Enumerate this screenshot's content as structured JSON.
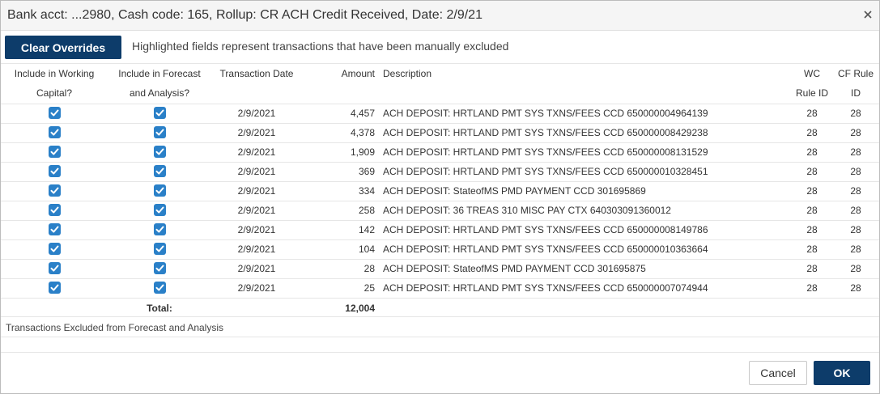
{
  "dialog": {
    "title": "Bank acct: ...2980, Cash code: 165, Rollup: CR ACH Credit Received, Date: 2/9/21",
    "close_icon": "close-icon"
  },
  "toolbar": {
    "clear_label": "Clear Overrides",
    "hint": "Highlighted fields represent transactions that have been manually excluded"
  },
  "columns": {
    "include_wc": [
      "Include in Working",
      "Capital?"
    ],
    "include_fa": [
      "Include in Forecast",
      "and Analysis?"
    ],
    "date": "Transaction Date",
    "amount": "Amount",
    "description": "Description",
    "wc_rule": [
      "WC",
      "Rule ID"
    ],
    "cf_rule": [
      "CF Rule",
      "ID"
    ]
  },
  "colors": {
    "primary": "#0d3c6a",
    "checkbox": "#2a80c8"
  },
  "rows": [
    {
      "include_wc": true,
      "include_fa": true,
      "date": "2/9/2021",
      "amount": "4,457",
      "description": "ACH DEPOSIT: HRTLAND PMT SYS TXNS/FEES CCD 650000004964139",
      "wc_rule": "28",
      "cf_rule": "28"
    },
    {
      "include_wc": true,
      "include_fa": true,
      "date": "2/9/2021",
      "amount": "4,378",
      "description": "ACH DEPOSIT: HRTLAND PMT SYS TXNS/FEES CCD 650000008429238",
      "wc_rule": "28",
      "cf_rule": "28"
    },
    {
      "include_wc": true,
      "include_fa": true,
      "date": "2/9/2021",
      "amount": "1,909",
      "description": "ACH DEPOSIT: HRTLAND PMT SYS TXNS/FEES CCD 650000008131529",
      "wc_rule": "28",
      "cf_rule": "28"
    },
    {
      "include_wc": true,
      "include_fa": true,
      "date": "2/9/2021",
      "amount": "369",
      "description": "ACH DEPOSIT: HRTLAND PMT SYS TXNS/FEES CCD 650000010328451",
      "wc_rule": "28",
      "cf_rule": "28"
    },
    {
      "include_wc": true,
      "include_fa": true,
      "date": "2/9/2021",
      "amount": "334",
      "description": "ACH DEPOSIT: StateofMS PMD PAYMENT CCD 301695869",
      "wc_rule": "28",
      "cf_rule": "28"
    },
    {
      "include_wc": true,
      "include_fa": true,
      "date": "2/9/2021",
      "amount": "258",
      "description": "ACH DEPOSIT: 36 TREAS 310 MISC PAY CTX 640303091360012",
      "wc_rule": "28",
      "cf_rule": "28"
    },
    {
      "include_wc": true,
      "include_fa": true,
      "date": "2/9/2021",
      "amount": "142",
      "description": "ACH DEPOSIT: HRTLAND PMT SYS TXNS/FEES CCD 650000008149786",
      "wc_rule": "28",
      "cf_rule": "28"
    },
    {
      "include_wc": true,
      "include_fa": true,
      "date": "2/9/2021",
      "amount": "104",
      "description": "ACH DEPOSIT: HRTLAND PMT SYS TXNS/FEES CCD 650000010363664",
      "wc_rule": "28",
      "cf_rule": "28"
    },
    {
      "include_wc": true,
      "include_fa": true,
      "date": "2/9/2021",
      "amount": "28",
      "description": "ACH DEPOSIT: StateofMS PMD PAYMENT CCD 301695875",
      "wc_rule": "28",
      "cf_rule": "28"
    },
    {
      "include_wc": true,
      "include_fa": true,
      "date": "2/9/2021",
      "amount": "25",
      "description": "ACH DEPOSIT: HRTLAND PMT SYS TXNS/FEES CCD 650000007074944",
      "wc_rule": "28",
      "cf_rule": "28"
    }
  ],
  "total": {
    "label": "Total:",
    "amount": "12,004"
  },
  "excluded_section": {
    "label": "Transactions Excluded from Forecast and Analysis"
  },
  "footer": {
    "cancel_label": "Cancel",
    "ok_label": "OK"
  }
}
